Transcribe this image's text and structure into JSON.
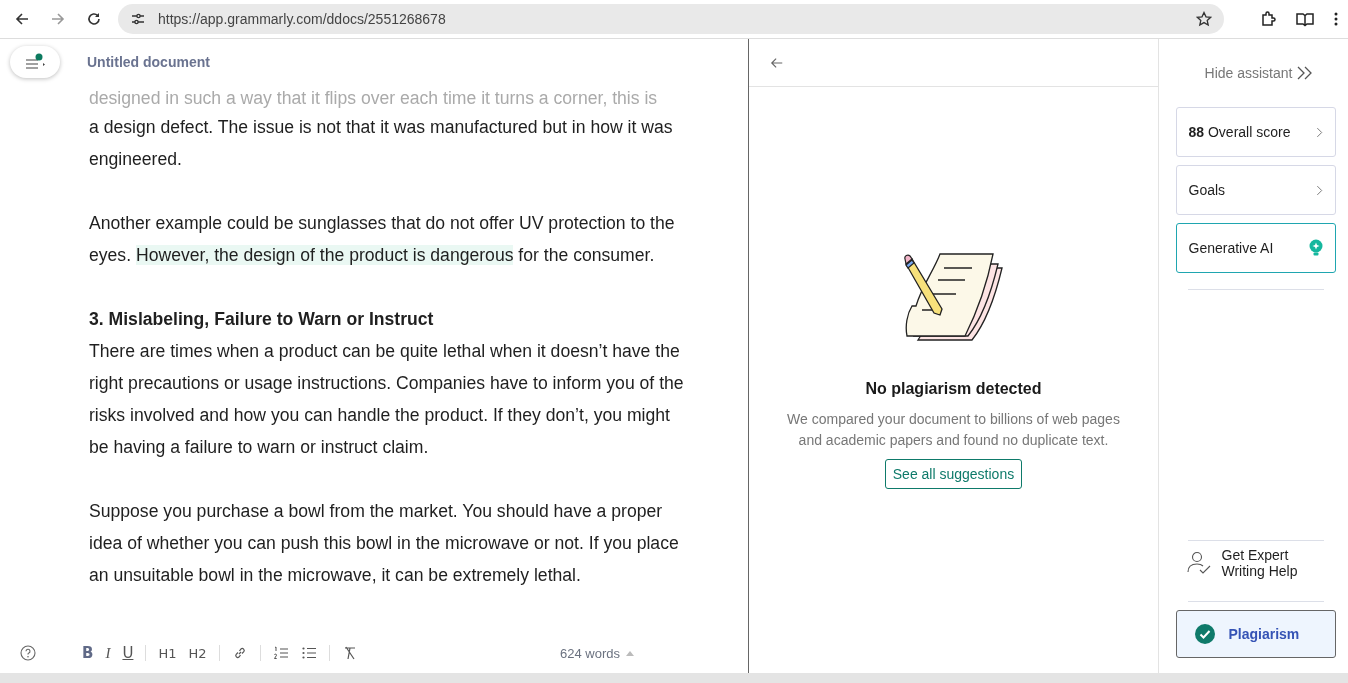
{
  "browser": {
    "url": "https://app.grammarly.com/ddocs/2551268678"
  },
  "document": {
    "title": "Untitled document",
    "blocks": [
      {
        "kind": "cut",
        "segments": [
          {
            "text": "designed in such a way that it flips over each time it turns a corner, this is",
            "highlighted": false
          }
        ]
      },
      {
        "kind": "paragraph",
        "segments": [
          {
            "text": "a design defect. The issue is not that it was manufactured but in how it was engineered.",
            "highlighted": false
          }
        ]
      },
      {
        "kind": "paragraph",
        "segments": [
          {
            "text": "Another example could be sunglasses that do not offer UV protection to the eyes. ",
            "highlighted": false
          },
          {
            "text": "However, the design of the product is dangerous",
            "highlighted": true
          },
          {
            "text": " for the consumer.",
            "highlighted": false
          }
        ]
      },
      {
        "kind": "heading",
        "segments": [
          {
            "text": "3. Mislabeling, Failure to Warn or Instruct",
            "highlighted": false
          }
        ]
      },
      {
        "kind": "paragraph",
        "segments": [
          {
            "text": "There are times when a product can be quite lethal when it doesn’t have the right precautions or usage instructions. Companies have to inform you of the risks involved and how you can handle the product. If they don’t, you might be having a failure to warn or instruct claim.",
            "highlighted": false
          }
        ]
      },
      {
        "kind": "paragraph",
        "segments": [
          {
            "text": "Suppose you purchase a bowl from the market. You should have a proper idea of whether you can push this bowl in the microwave or not. If you place an unsuitable bowl in the microwave, it can be extremely lethal.",
            "highlighted": false
          }
        ]
      }
    ]
  },
  "toolbar": {
    "buttons": [
      {
        "kind": "bold",
        "label": "B"
      },
      {
        "kind": "italic",
        "label": "I"
      },
      {
        "kind": "underline",
        "label": "U"
      },
      {
        "kind": "sep"
      },
      {
        "kind": "heading",
        "label": "H1"
      },
      {
        "kind": "heading",
        "label": "H2"
      },
      {
        "kind": "sep"
      },
      {
        "kind": "link"
      },
      {
        "kind": "sep"
      },
      {
        "kind": "ordered"
      },
      {
        "kind": "bullets"
      },
      {
        "kind": "sep"
      },
      {
        "kind": "clear"
      }
    ],
    "word_count": "624 words"
  },
  "plagiarism": {
    "title": "No plagiarism detected",
    "description": "We compared your document to billions of web pages and academic papers and found no duplicate text.",
    "button": "See all suggestions"
  },
  "assistant": {
    "hide": "Hide assistant",
    "items": [
      {
        "kind": "score",
        "score": "88",
        "label": "Overall score",
        "selected": false
      },
      {
        "kind": "goals",
        "label": "Goals",
        "selected": false
      },
      {
        "kind": "ai",
        "label": "Generative AI",
        "selected": false
      }
    ],
    "expert": "Get Expert Writing Help",
    "plagiarism_item": {
      "label": "Plagiarism",
      "selected": true
    }
  }
}
